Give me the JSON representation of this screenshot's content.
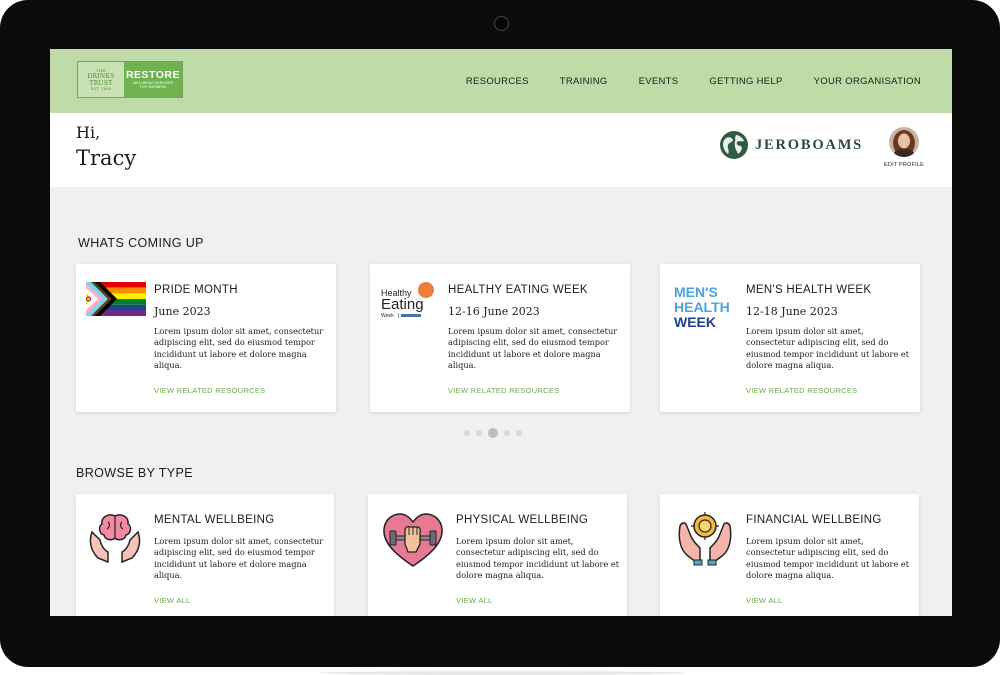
{
  "logo": {
    "left_lines": [
      "THE",
      "DRINKS",
      "TRUST",
      "EST. 1886"
    ],
    "brand": "RESTORE",
    "tagline_1": "WELLBEING SERVICES",
    "tagline_2": "FOR BUSINESS",
    "colors": {
      "light": "#c9e2b4",
      "dark": "#6fb24f"
    }
  },
  "nav": {
    "items": [
      "RESOURCES",
      "TRAINING",
      "EVENTS",
      "GETTING HELP",
      "YOUR ORGANISATION"
    ],
    "background": "#bfdca8"
  },
  "greeting": {
    "hi": "Hi,",
    "name": "Tracy"
  },
  "org_logo": {
    "text": "JEROBOAMS",
    "icon": "globe-icon"
  },
  "profile": {
    "edit_label": "EDIT PROFILE",
    "icon": "avatar"
  },
  "upcoming": {
    "title": "WHATS COMING UP",
    "cards": [
      {
        "title": "PRIDE MONTH",
        "date": "June 2023",
        "body": "Lorem ipsum dolor sit amet, consectetur adipiscing elit, sed do eiusmod tempor incididunt ut labore et dolore magna aliqua.",
        "link": "VIEW RELATED RESOURCES",
        "icon": "pride-flag-icon"
      },
      {
        "title": "HEALTHY EATING WEEK",
        "date": "12-16 June 2023",
        "body": "Lorem ipsum dolor sit amet, consectetur adipiscing elit, sed do eiusmod tempor incididunt ut labore et dolore magna aliqua.",
        "link": "VIEW RELATED RESOURCES",
        "icon": "healthy-eating-logo",
        "logo_text": {
          "l1": "Healthy",
          "l2": "Eating",
          "l3": "Week"
        }
      },
      {
        "title": "MEN'S HEALTH WEEK",
        "date": "12-18 June 2023",
        "body": "Lorem ipsum dolor sit amet, consectetur adipiscing elit, sed do eiusmod tempor incididunt ut labore et dolore magna aliqua.",
        "link": "VIEW RELATED RESOURCES",
        "icon": "mens-health-week-logo",
        "logo_text": {
          "l1": "MEN'S",
          "l2": "HEALTH",
          "l3": "WEEK"
        }
      }
    ],
    "carousel": {
      "count": 5,
      "active": 2
    }
  },
  "browse": {
    "title": "BROWSE BY TYPE",
    "cards": [
      {
        "title": "MENTAL WELLBEING",
        "body": "Lorem ipsum dolor sit amet, consectetur adipiscing elit, sed do eiusmod tempor incididunt ut labore et dolore magna aliqua.",
        "link": "VIEW ALL",
        "icon": "brain-hands-icon"
      },
      {
        "title": "PHYSICAL WELLBEING",
        "body": "Lorem ipsum dolor sit amet, consectetur adipiscing elit, sed do eiusmod tempor incididunt ut labore et dolore magna aliqua.",
        "link": "VIEW ALL",
        "icon": "heart-dumbbell-icon"
      },
      {
        "title": "FINANCIAL WELLBEING",
        "body": "Lorem ipsum dolor sit amet, consectetur adipiscing elit, sed do eiusmod tempor incididunt ut labore et dolore magna aliqua.",
        "link": "VIEW ALL",
        "icon": "hands-coin-icon"
      }
    ]
  },
  "colors": {
    "accent": "#6ca84c",
    "page_bg": "#f1f0f0",
    "device": "#0b0b0c"
  }
}
